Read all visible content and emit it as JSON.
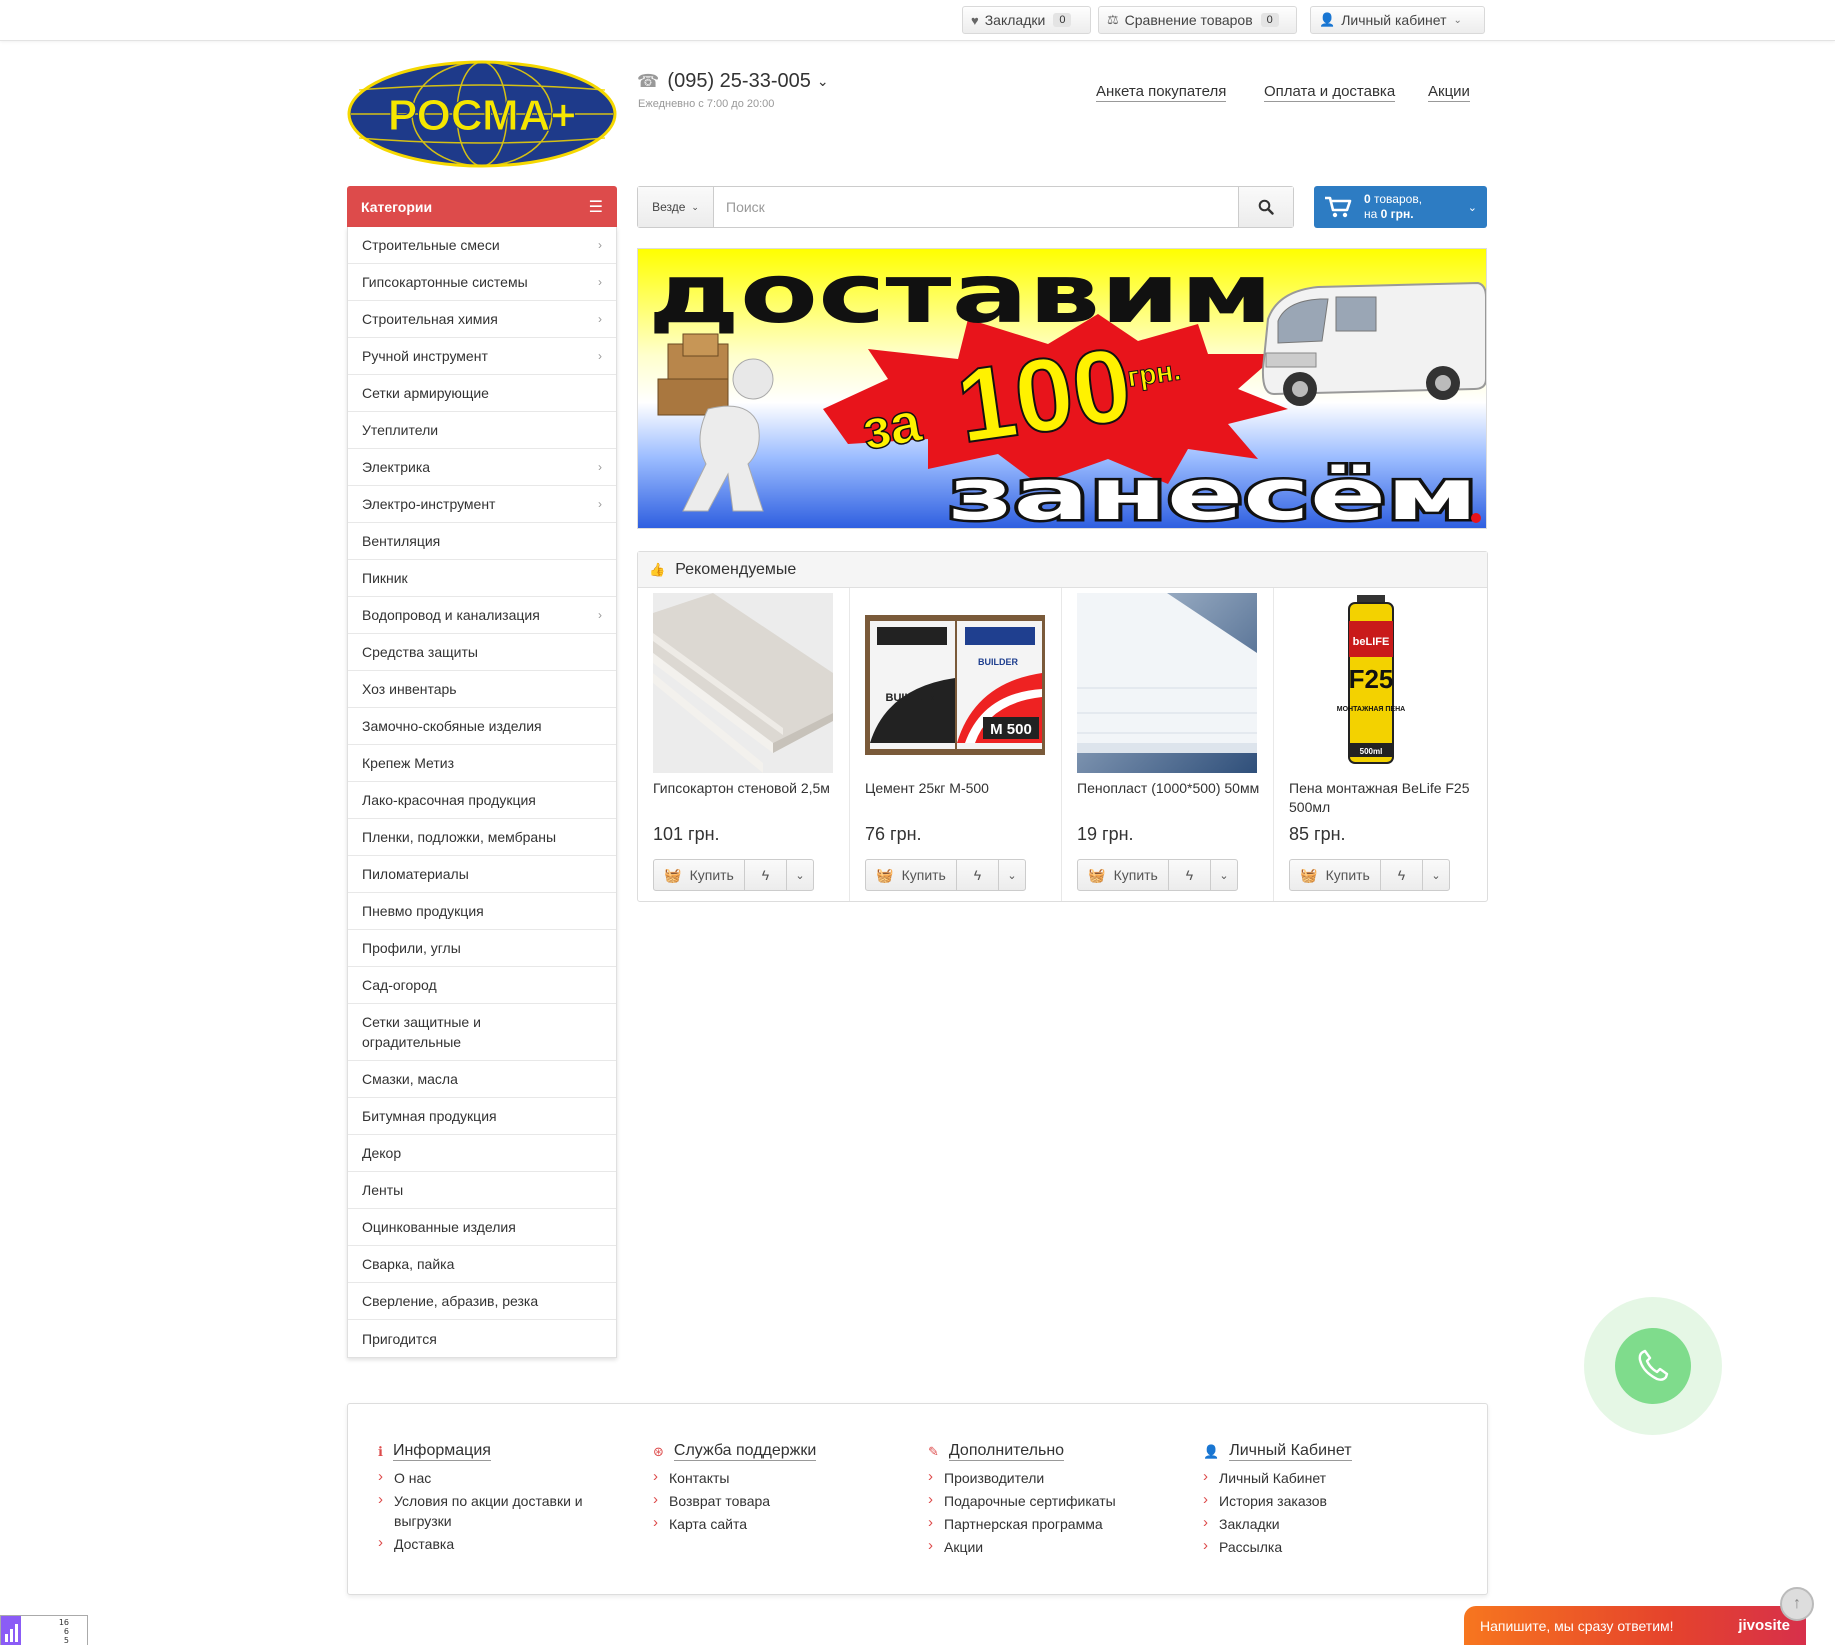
{
  "topbar": {
    "bookmarks_label": "Закладки",
    "bookmarks_count": "0",
    "compare_label": "Сравнение товаров",
    "compare_count": "0",
    "account_label": "Личный кабинет"
  },
  "header": {
    "logo_text": "РОСМА+",
    "phone": "(095) 25-33-005",
    "hours": "Ежедневно с 7:00 до 20:00",
    "nav": [
      "Анкета покупателя",
      "Оплата и доставка",
      "Акции"
    ]
  },
  "categories": {
    "title": "Категории",
    "items": [
      {
        "label": "Строительные смеси",
        "sub": true
      },
      {
        "label": "Гипсокартонные системы",
        "sub": true
      },
      {
        "label": "Строительная химия",
        "sub": true
      },
      {
        "label": "Ручной инструмент",
        "sub": true
      },
      {
        "label": "Сетки армирующие",
        "sub": false
      },
      {
        "label": "Утеплители",
        "sub": false
      },
      {
        "label": "Электрика",
        "sub": true
      },
      {
        "label": "Электро-инструмент",
        "sub": true
      },
      {
        "label": "Вентиляция",
        "sub": false
      },
      {
        "label": "Пикник",
        "sub": false
      },
      {
        "label": "Водопровод и канализация",
        "sub": true
      },
      {
        "label": "Средства защиты",
        "sub": false
      },
      {
        "label": "Хоз инвентарь",
        "sub": false
      },
      {
        "label": "Замочно-скобяные изделия",
        "sub": false
      },
      {
        "label": "Крепеж Метиз",
        "sub": false
      },
      {
        "label": "Лако-красочная продукция",
        "sub": false
      },
      {
        "label": "Пленки, подложки, мембраны",
        "sub": false
      },
      {
        "label": "Пиломатериалы",
        "sub": false
      },
      {
        "label": "Пневмо продукция",
        "sub": false
      },
      {
        "label": "Профили, углы",
        "sub": false
      },
      {
        "label": "Сад-огород",
        "sub": false
      },
      {
        "label": "Сетки защитные и оградительные",
        "sub": false,
        "tall": true
      },
      {
        "label": "Смазки, масла",
        "sub": false
      },
      {
        "label": "Битумная продукция",
        "sub": false
      },
      {
        "label": "Декор",
        "sub": false
      },
      {
        "label": "Ленты",
        "sub": false
      },
      {
        "label": "Оцинкованные изделия",
        "sub": false
      },
      {
        "label": "Сварка, пайка",
        "sub": false
      },
      {
        "label": "Сверление, абразив, резка",
        "sub": false
      },
      {
        "label": "Пригодится",
        "sub": false
      }
    ]
  },
  "search": {
    "scope": "Везде",
    "placeholder": "Поиск",
    "value": ""
  },
  "cart": {
    "count": "0",
    "count_suffix": " товаров,",
    "total_prefix": "на ",
    "total": "0 грн."
  },
  "banner": {
    "line1": "доставим",
    "za": "за",
    "amount": "100",
    "currency": "грн.",
    "line2": "занесём"
  },
  "recommended": {
    "title": "Рекомендуемые",
    "buy_label": "Купить",
    "products": [
      {
        "name": "Гипсокартон стеновой 2,5м",
        "price": "101 грн."
      },
      {
        "name": "Цемент 25кг М-500",
        "price": "76 грн."
      },
      {
        "name": "Пенопласт (1000*500) 50мм",
        "price": "19 грн."
      },
      {
        "name": "Пена монтажная BeLife F25 500мл",
        "price": "85 грн."
      }
    ],
    "cement_brand": "BUILDER",
    "cement_grade": "М 500",
    "foam_brand": "beLIFE",
    "foam_code": "F25",
    "foam_text": "МОНТАЖНАЯ ПЕНА",
    "foam_volume": "500ml"
  },
  "footer": {
    "columns": [
      {
        "title": "Информация",
        "icon": "info-icon",
        "links": [
          "О нас",
          "Условия по акции доставки и выгрузки",
          "Доставка"
        ]
      },
      {
        "title": "Служба поддержки",
        "icon": "lifebuoy-icon",
        "links": [
          "Контакты",
          "Возврат товара",
          "Карта сайта"
        ]
      },
      {
        "title": "Дополнительно",
        "icon": "pin-icon",
        "links": [
          "Производители",
          "Подарочные сертификаты",
          "Партнерская программа",
          "Акции"
        ]
      },
      {
        "title": "Личный Кабинет",
        "icon": "user-icon",
        "links": [
          "Личный Кабинет",
          "История заказов",
          "Закладки",
          "Рассылка"
        ]
      }
    ]
  },
  "jivo": {
    "message": "Напишите, мы сразу ответим!",
    "brand": "jivosite"
  },
  "counter": {
    "lines": [
      "16",
      "6",
      "5"
    ]
  },
  "colors": {
    "accent_red": "#dd4b4b",
    "cart_blue": "#2d7cc3",
    "call_green": "#7fdc8c"
  }
}
